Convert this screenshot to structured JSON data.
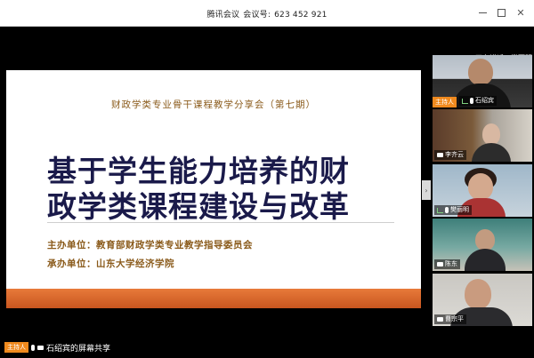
{
  "window": {
    "title_app": "腾讯会议",
    "title_meeting_label": "会议号:",
    "title_meeting_id": "623 452 921"
  },
  "controls": {
    "minimize_icon": "minimize-icon",
    "maximize_icon": "maximize-icon",
    "close_icon": "close-icon"
  },
  "slide": {
    "subtitle": "财政学类专业骨干课程教学分享会（第七期）",
    "title_line1": "基于学生能力培养的财",
    "title_line2": "政学类课程建设与改革",
    "organizer": "主办单位：教育部财政学类专业教学指导委员会",
    "host_org": "承办单位：山东大学经济学院"
  },
  "speaking": "正在讲话：樊丽明",
  "participants": [
    {
      "name": "石绍宾",
      "role": "主持人"
    },
    {
      "name": "李齐云"
    },
    {
      "name": "樊丽明"
    },
    {
      "name": "陈东"
    },
    {
      "name": "曹宗平"
    }
  ],
  "share_bar": {
    "host_tag": "主持人",
    "text": "石绍宾的屏幕共享"
  },
  "colors": {
    "accent_orange": "#f08a1e",
    "slide_band": "#d8632a",
    "slide_title": "#1a1a4a",
    "slide_text": "#8a5a1a"
  }
}
